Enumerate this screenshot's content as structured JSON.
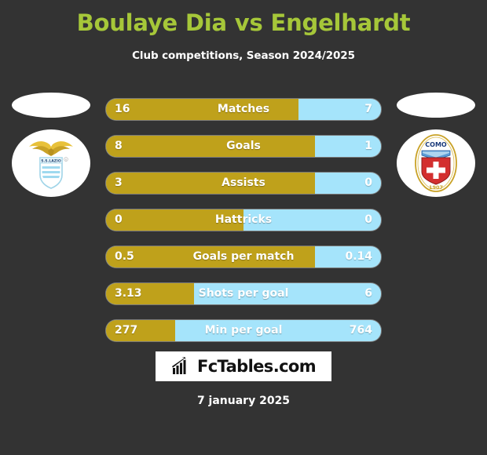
{
  "header": {
    "title": "Boulaye Dia vs Engelhardt",
    "subtitle": "Club competitions, Season 2024/2025",
    "title_color": "#a6c739",
    "subtitle_color": "#ffffff"
  },
  "theme": {
    "background": "#333333",
    "home_bar_color": "#bfa11b",
    "away_bar_color": "#a5e4fb",
    "value_text_color": "#ffffff"
  },
  "teams": {
    "home": {
      "crest_name": "ss-lazio-crest",
      "crest_text_top": "S.S.LAZIO"
    },
    "away": {
      "crest_name": "como-1907-crest",
      "crest_text_top": "COMO",
      "crest_text_bottom": "1907"
    }
  },
  "stats": [
    {
      "label": "Matches",
      "home": "16",
      "away": "7",
      "home_pct": 70
    },
    {
      "label": "Goals",
      "home": "8",
      "away": "1",
      "home_pct": 76
    },
    {
      "label": "Assists",
      "home": "3",
      "away": "0",
      "home_pct": 76
    },
    {
      "label": "Hattricks",
      "home": "0",
      "away": "0",
      "home_pct": 50
    },
    {
      "label": "Goals per match",
      "home": "0.5",
      "away": "0.14",
      "home_pct": 76
    },
    {
      "label": "Shots per goal",
      "home": "3.13",
      "away": "6",
      "home_pct": 32
    },
    {
      "label": "Min per goal",
      "home": "277",
      "away": "764",
      "home_pct": 25
    }
  ],
  "footer": {
    "logo_text": "FcTables.com",
    "logo_icon": "bar-chart-arrow-icon",
    "date": "7 january 2025"
  }
}
